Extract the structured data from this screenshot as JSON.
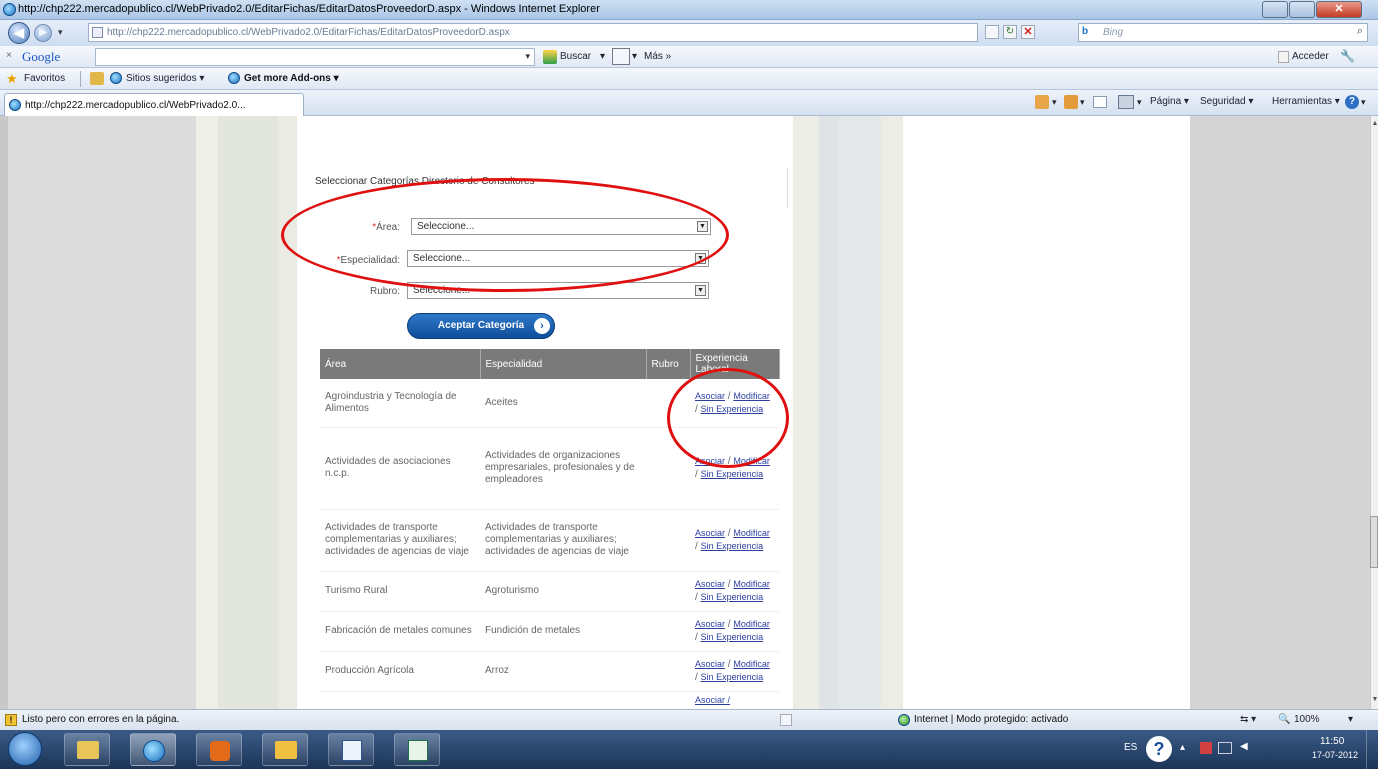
{
  "window": {
    "title": "http://chp222.mercadopublico.cl/WebPrivado2.0/EditarFichas/EditarDatosProveedorD.aspx - Windows Internet Explorer"
  },
  "address_bar": {
    "url": "http://chp222.mercadopublico.cl/WebPrivado2.0/EditarFichas/EditarDatosProveedorD.aspx",
    "search_placeholder": "Bing"
  },
  "google_bar": {
    "logo": "Google",
    "search_button": "Buscar",
    "more": "Más »",
    "signin": "Acceder"
  },
  "favorites_bar": {
    "favorites": "Favoritos",
    "suggested": "Sitios sugeridos ▾",
    "addons": "Get more Add-ons ▾"
  },
  "tab": {
    "title": "http://chp222.mercadopublico.cl/WebPrivado2.0..."
  },
  "command_bar": {
    "page": "Página ▾",
    "security": "Seguridad ▾",
    "tools": "Herramientas ▾"
  },
  "form": {
    "heading": "Seleccionar Categorías Directorio de Consultores",
    "area_label": "Área:",
    "area_value": "Seleccione...",
    "specialty_label": "Especialidad:",
    "specialty_value": "Seleccione...",
    "rubro_label": "Rubro:",
    "rubro_value": "Seleccione...",
    "required_mark": "*",
    "accept_button": "Aceptar Categoría"
  },
  "table": {
    "headers": [
      "Área",
      "Especialidad",
      "Rubro",
      "Experiencia Laboral"
    ],
    "rows": [
      {
        "area": "Agroindustria y Tecnología de Alimentos",
        "specialty": "Aceites"
      },
      {
        "area": "Actividades de asociaciones n.c.p.",
        "specialty": "Actividades de organizaciones empresariales, profesionales y de empleadores"
      },
      {
        "area": "Actividades de transporte complementarias y auxiliares; actividades de agencias de viaje",
        "specialty": "Actividades de transporte complementarias y auxiliares; actividades de agencias de viaje"
      },
      {
        "area": "Turismo Rural",
        "specialty": "Agroturismo"
      },
      {
        "area": "Fabricación de metales comunes",
        "specialty": "Fundición de metales"
      },
      {
        "area": "Producción Agrícola",
        "specialty": "Arroz"
      }
    ],
    "action_links": {
      "associate": "Asociar",
      "modify": "Modificar",
      "none": "Sin Experiencia"
    },
    "partial_row_link": "Asociar /"
  },
  "status_bar": {
    "message": "Listo pero con errores en la página.",
    "zone": "Internet | Modo protegido: activado",
    "zoom": "100%"
  },
  "taskbar": {
    "lang": "ES",
    "time": "11:50",
    "date": "17-07-2012"
  }
}
